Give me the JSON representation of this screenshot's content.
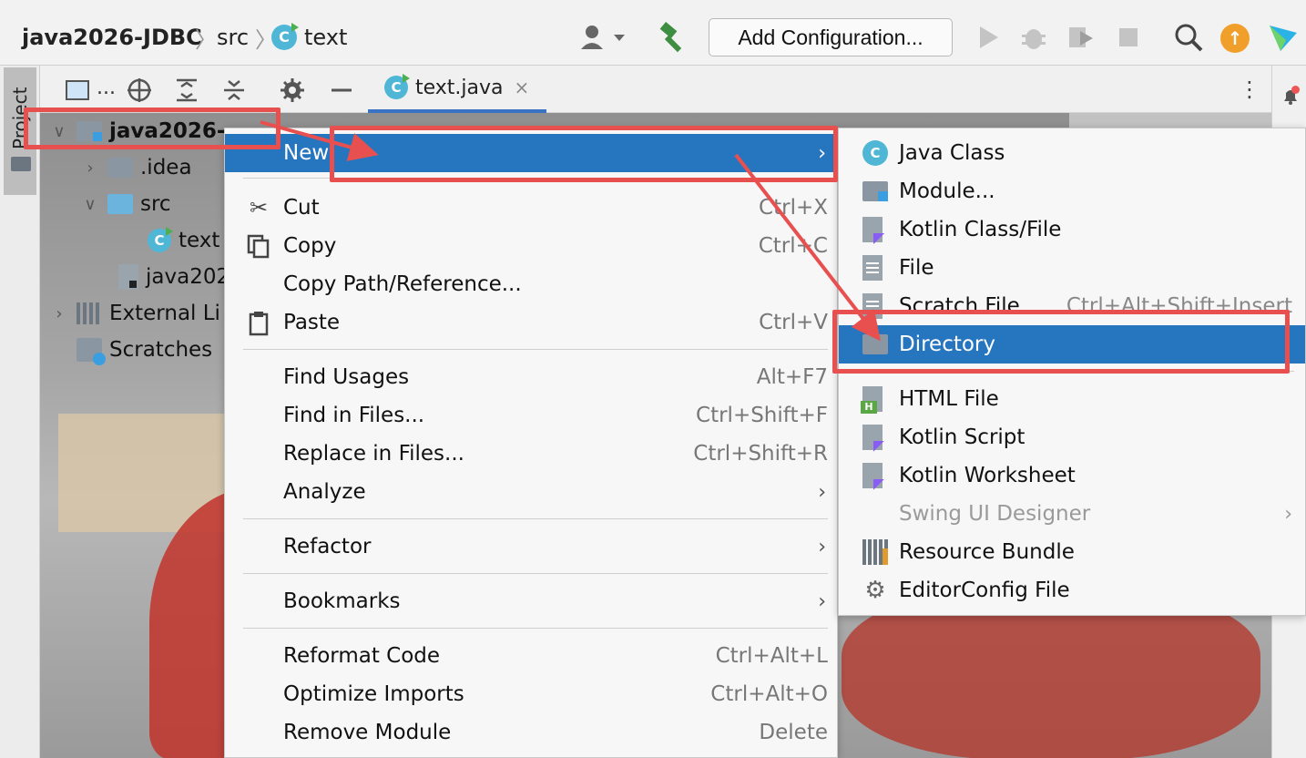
{
  "navbar": {
    "project": "java2026-JDBC",
    "sep": "〉",
    "folder": "src",
    "file": "text",
    "add_configuration": "Add Configuration..."
  },
  "left_strip": {
    "project_tab": "Project"
  },
  "editor": {
    "tab_label": "text.java",
    "tab_close": "×"
  },
  "project_toolbar": {
    "dots": "..."
  },
  "tree": [
    {
      "label": "java2026-",
      "chevron": "∨"
    },
    {
      "label": ".idea",
      "chevron": "›"
    },
    {
      "label": "src",
      "chevron": "∨"
    },
    {
      "label": "text"
    },
    {
      "label": "java202"
    },
    {
      "label": "External Li",
      "chevron": "›"
    },
    {
      "label": "Scratches"
    }
  ],
  "context_menu": {
    "items": [
      {
        "label": "New",
        "shortcut": "",
        "arrow": "›",
        "icon": ""
      },
      {
        "label": "Cut",
        "shortcut": "Ctrl+X",
        "icon": "scissors-icon"
      },
      {
        "label": "Copy",
        "shortcut": "Ctrl+C",
        "icon": "copy-icon"
      },
      {
        "label": "Copy Path/Reference...",
        "shortcut": ""
      },
      {
        "label": "Paste",
        "shortcut": "Ctrl+V",
        "icon": "clipboard-icon"
      },
      {
        "label": "Find Usages",
        "shortcut": "Alt+F7"
      },
      {
        "label": "Find in Files...",
        "shortcut": "Ctrl+Shift+F"
      },
      {
        "label": "Replace in Files...",
        "shortcut": "Ctrl+Shift+R"
      },
      {
        "label": "Analyze",
        "arrow": "›"
      },
      {
        "label": "Refactor",
        "arrow": "›"
      },
      {
        "label": "Bookmarks",
        "arrow": "›"
      },
      {
        "label": "Reformat Code",
        "shortcut": "Ctrl+Alt+L"
      },
      {
        "label": "Optimize Imports",
        "shortcut": "Ctrl+Alt+O"
      },
      {
        "label": "Remove Module",
        "shortcut": "Delete"
      }
    ]
  },
  "new_submenu": {
    "items": [
      {
        "label": "Java Class",
        "icon": "java-class-icon"
      },
      {
        "label": "Module...",
        "icon": "module-icon"
      },
      {
        "label": "Kotlin Class/File",
        "icon": "kotlin-file-icon"
      },
      {
        "label": "File",
        "icon": "file-icon"
      },
      {
        "label": "Scratch File",
        "shortcut": "Ctrl+Alt+Shift+Insert",
        "icon": "scratch-file-icon"
      },
      {
        "label": "Directory",
        "icon": "folder-icon"
      },
      {
        "label": "HTML File",
        "icon": "html-file-icon"
      },
      {
        "label": "Kotlin Script",
        "icon": "kotlin-script-icon"
      },
      {
        "label": "Kotlin Worksheet",
        "icon": "kotlin-worksheet-icon"
      },
      {
        "label": "Swing UI Designer",
        "arrow": "›"
      },
      {
        "label": "Resource Bundle",
        "icon": "resource-bundle-icon"
      },
      {
        "label": "EditorConfig File",
        "icon": "gear-icon"
      }
    ]
  },
  "colors": {
    "selection": "#2675bf",
    "annotation_red": "#e8504f",
    "java_class": "#4fb6d6"
  }
}
